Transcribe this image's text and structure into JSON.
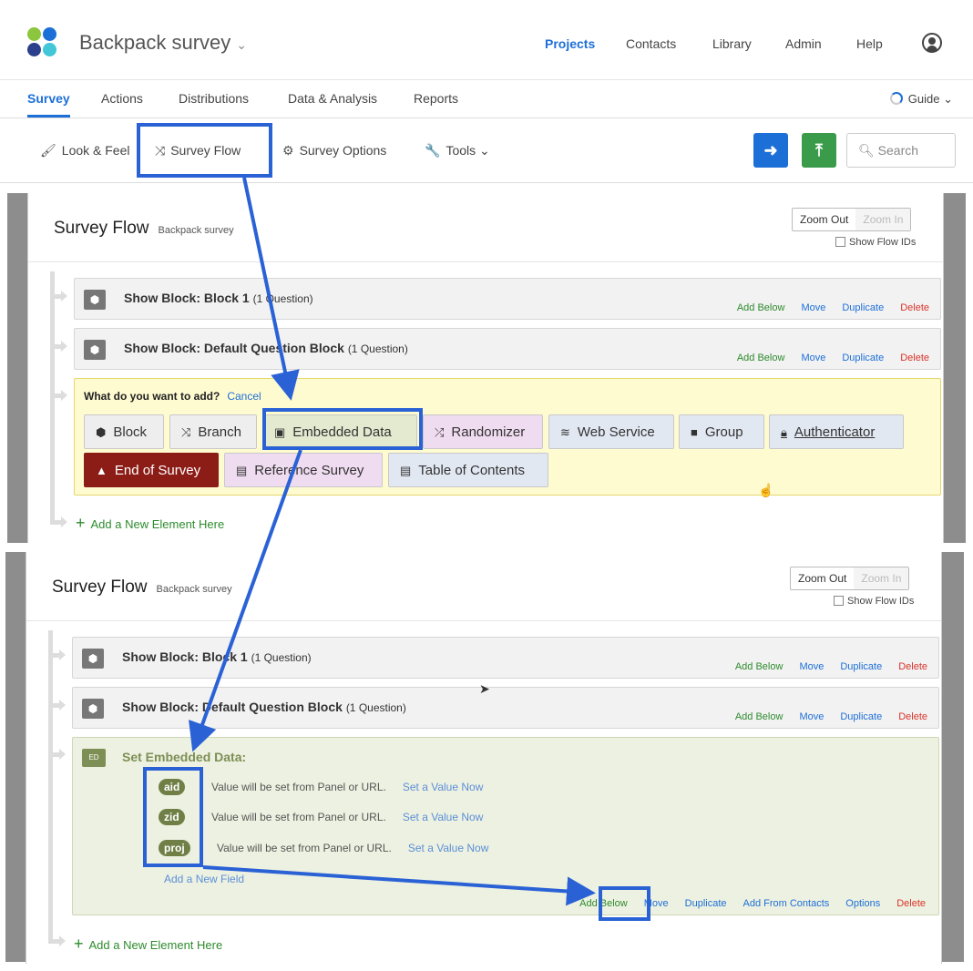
{
  "header": {
    "title": "Backpack survey",
    "nav": [
      "Projects",
      "Contacts",
      "Library",
      "Admin",
      "Help"
    ],
    "logo_colors": [
      "#8cc63f",
      "#1d6fd8",
      "#2b3f8c",
      "#42c6d8"
    ]
  },
  "subnav": {
    "tabs": [
      "Survey",
      "Actions",
      "Distributions",
      "Data & Analysis",
      "Reports"
    ],
    "guide": "Guide"
  },
  "toolbar": {
    "look_feel": "Look & Feel",
    "survey_flow": "Survey Flow",
    "survey_options": "Survey Options",
    "tools": "Tools",
    "search_placeholder": "Search",
    "colors": {
      "preview": "#1d6fd8",
      "publish": "#3a9c4a"
    }
  },
  "panel1": {
    "title": "Survey Flow",
    "subtitle": "Backpack survey",
    "zoom_out": "Zoom Out",
    "zoom_in": "Zoom In",
    "show_flow_ids": "Show Flow IDs",
    "blocks": [
      {
        "title": "Show Block: Block 1",
        "count": "(1 Question)"
      },
      {
        "title": "Show Block: Default Question Block",
        "count": "(1 Question)"
      }
    ],
    "actions": {
      "add_below": "Add Below",
      "move": "Move",
      "duplicate": "Duplicate",
      "delete": "Delete"
    },
    "add_prompt": "What do you want to add?",
    "cancel": "Cancel",
    "options": [
      "Block",
      "Branch",
      "Embedded Data",
      "Randomizer",
      "Web Service",
      "Group",
      "Authenticator",
      "End of Survey",
      "Reference Survey",
      "Table of Contents"
    ],
    "add_new": "Add a New Element Here"
  },
  "panel2": {
    "title": "Survey Flow",
    "subtitle": "Backpack survey",
    "zoom_out": "Zoom Out",
    "zoom_in": "Zoom In",
    "show_flow_ids": "Show Flow IDs",
    "blocks": [
      {
        "title": "Show Block: Block 1",
        "count": "(1 Question)"
      },
      {
        "title": "Show Block: Default Question Block",
        "count": "(1 Question)"
      }
    ],
    "actions": {
      "add_below": "Add Below",
      "move": "Move",
      "duplicate": "Duplicate",
      "delete": "Delete"
    },
    "embedded": {
      "title": "Set Embedded Data:",
      "icon_label": "ED",
      "fields": [
        {
          "name": "aid",
          "text": "Value will be set from Panel or URL.",
          "link": "Set a Value Now"
        },
        {
          "name": "zid",
          "text": "Value will be set from Panel or URL.",
          "link": "Set a Value Now"
        },
        {
          "name": "proj",
          "text": "Value will be set from Panel or URL.",
          "link": "Set a Value Now"
        }
      ],
      "add_field": "Add a New Field",
      "actions": {
        "add_below": "Add Below",
        "move": "Move",
        "duplicate": "Duplicate",
        "add_from_contacts": "Add From Contacts",
        "options": "Options",
        "delete": "Delete"
      }
    },
    "add_new": "Add a New Element Here"
  },
  "annotation_color": "#2a62d6"
}
